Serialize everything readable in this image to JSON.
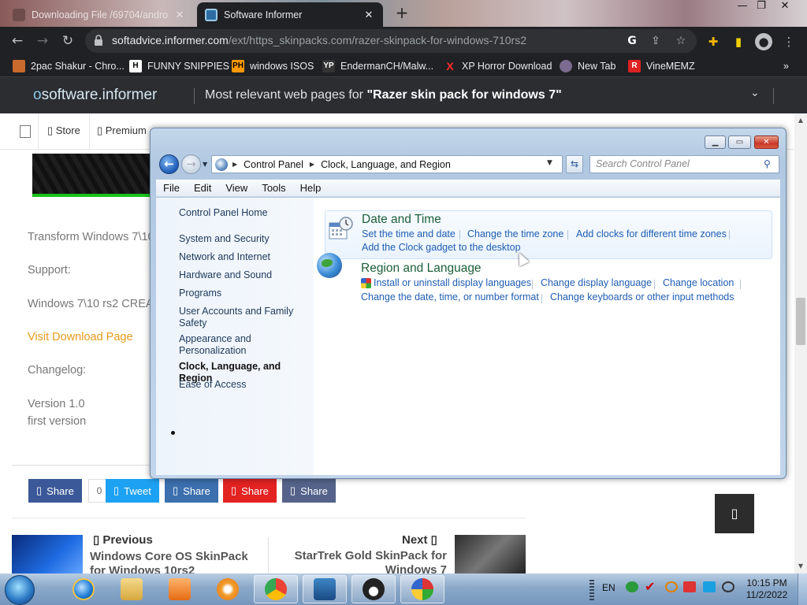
{
  "browser": {
    "tabs": [
      {
        "title": "Downloading File /69704/andro",
        "close": "✕"
      },
      {
        "title": "Software Informer",
        "close": "✕"
      }
    ],
    "new_tab": "+",
    "window_controls": {
      "minimize": "—",
      "restore": "❐",
      "close": "✕"
    },
    "url_host": "softadvice.informer.com",
    "url_path": "/ext/https_skinpacks.com/razer-skinpack-for-windows-710rs2",
    "bookmarks": [
      {
        "label": "2pac Shakur - Chro...",
        "badge": ""
      },
      {
        "label": "FUNNY SNIPPIES",
        "badge": "H"
      },
      {
        "label": "windows ISOS",
        "badge": "PH"
      },
      {
        "label": "EndermanCH/Malw...",
        "badge": "YP"
      },
      {
        "label": "XP Horror Download",
        "badge": "X"
      },
      {
        "label": "New Tab",
        "badge": ""
      },
      {
        "label": "VineMEMZ",
        "badge": "R"
      }
    ],
    "bookmarks_more": "»"
  },
  "site": {
    "logo_o": "o",
    "logo_rest": "software.informer",
    "header_prefix": "Most relevant web pages for ",
    "header_query": "\"Razer skin pack for windows 7\"",
    "nav": [
      "Store",
      "Premium"
    ],
    "body_lines": {
      "transform": "Transform Windows 7\\10",
      "support": "Support:",
      "windows": "Windows 7\\10 rs2 CREA",
      "visit": "Visit Download Page",
      "changelog": "Changelog:",
      "version": "Version 1.0",
      "first": "first version"
    },
    "share_buttons": [
      {
        "label": "Share",
        "color": "#3b5998"
      },
      {
        "label": "Tweet",
        "color": "#1da1f2"
      },
      {
        "label": "Share",
        "color": "#3c6fae"
      },
      {
        "label": "Share",
        "color": "#e32222"
      },
      {
        "label": "Share",
        "color": "#55638a"
      }
    ],
    "share_count": "0",
    "previous_label": "Previous",
    "previous_title": "Windows Core OS SkinPack for Windows 10rs2",
    "next_label": "Next",
    "next_title": "StarTrek Gold SkinPack for Windows 7"
  },
  "control_panel": {
    "breadcrumb": [
      "Control Panel",
      "Clock, Language, and Region"
    ],
    "search_placeholder": "Search Control Panel",
    "menu": [
      "File",
      "Edit",
      "View",
      "Tools",
      "Help"
    ],
    "left_pane": {
      "home": "Control Panel Home",
      "items": [
        "System and Security",
        "Network and Internet",
        "Hardware and Sound",
        "Programs",
        "User Accounts and Family Safety",
        "Appearance and Personalization",
        "Clock, Language, and Region",
        "Ease of Access"
      ],
      "current_index": 6
    },
    "categories": [
      {
        "title": "Date and Time",
        "links": [
          "Set the time and date",
          "Change the time zone",
          "Add clocks for different time zones",
          "Add the Clock gadget to the desktop"
        ]
      },
      {
        "title": "Region and Language",
        "links": [
          "Install or uninstall display languages",
          "Change display language",
          "Change location",
          "Change the date, time, or number format",
          "Change keyboards or other input methods"
        ]
      }
    ]
  },
  "taskbar": {
    "language": "EN",
    "time": "10:15 PM",
    "date": "11/2/2022"
  },
  "colors": {
    "link": "#1f5db3",
    "category_title": "#1c5f38",
    "chrome_dark": "#202124",
    "visit_orange": "#e79a1c"
  }
}
